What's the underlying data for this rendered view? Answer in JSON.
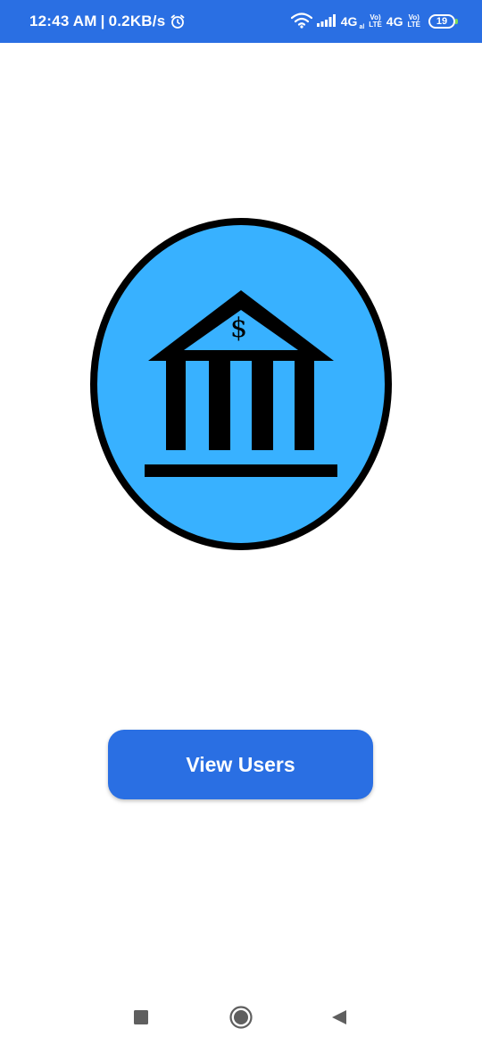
{
  "status_bar": {
    "time": "12:43 AM",
    "separator": "|",
    "speed": "0.2KB/s",
    "network_1": "4G",
    "network_1_sub": "al",
    "volte_1_top": "Vo)",
    "volte_1_bottom": "LTE",
    "network_2": "4G",
    "volte_2_top": "Vo)",
    "volte_2_bottom": "LTE",
    "battery_level": "19",
    "background_color": "#2a6fe3",
    "icons": [
      "alarm-icon",
      "wifi-icon",
      "signal-icon",
      "battery-icon"
    ]
  },
  "logo": {
    "icon": "bank-icon",
    "symbol": "$",
    "fill_color": "#38b1ff",
    "stroke_color": "#000000"
  },
  "main": {
    "view_users_label": "View Users",
    "button_color": "#2a6fe3"
  },
  "nav_bar": {
    "icons": [
      "recent-apps-icon",
      "home-icon",
      "back-icon"
    ]
  }
}
